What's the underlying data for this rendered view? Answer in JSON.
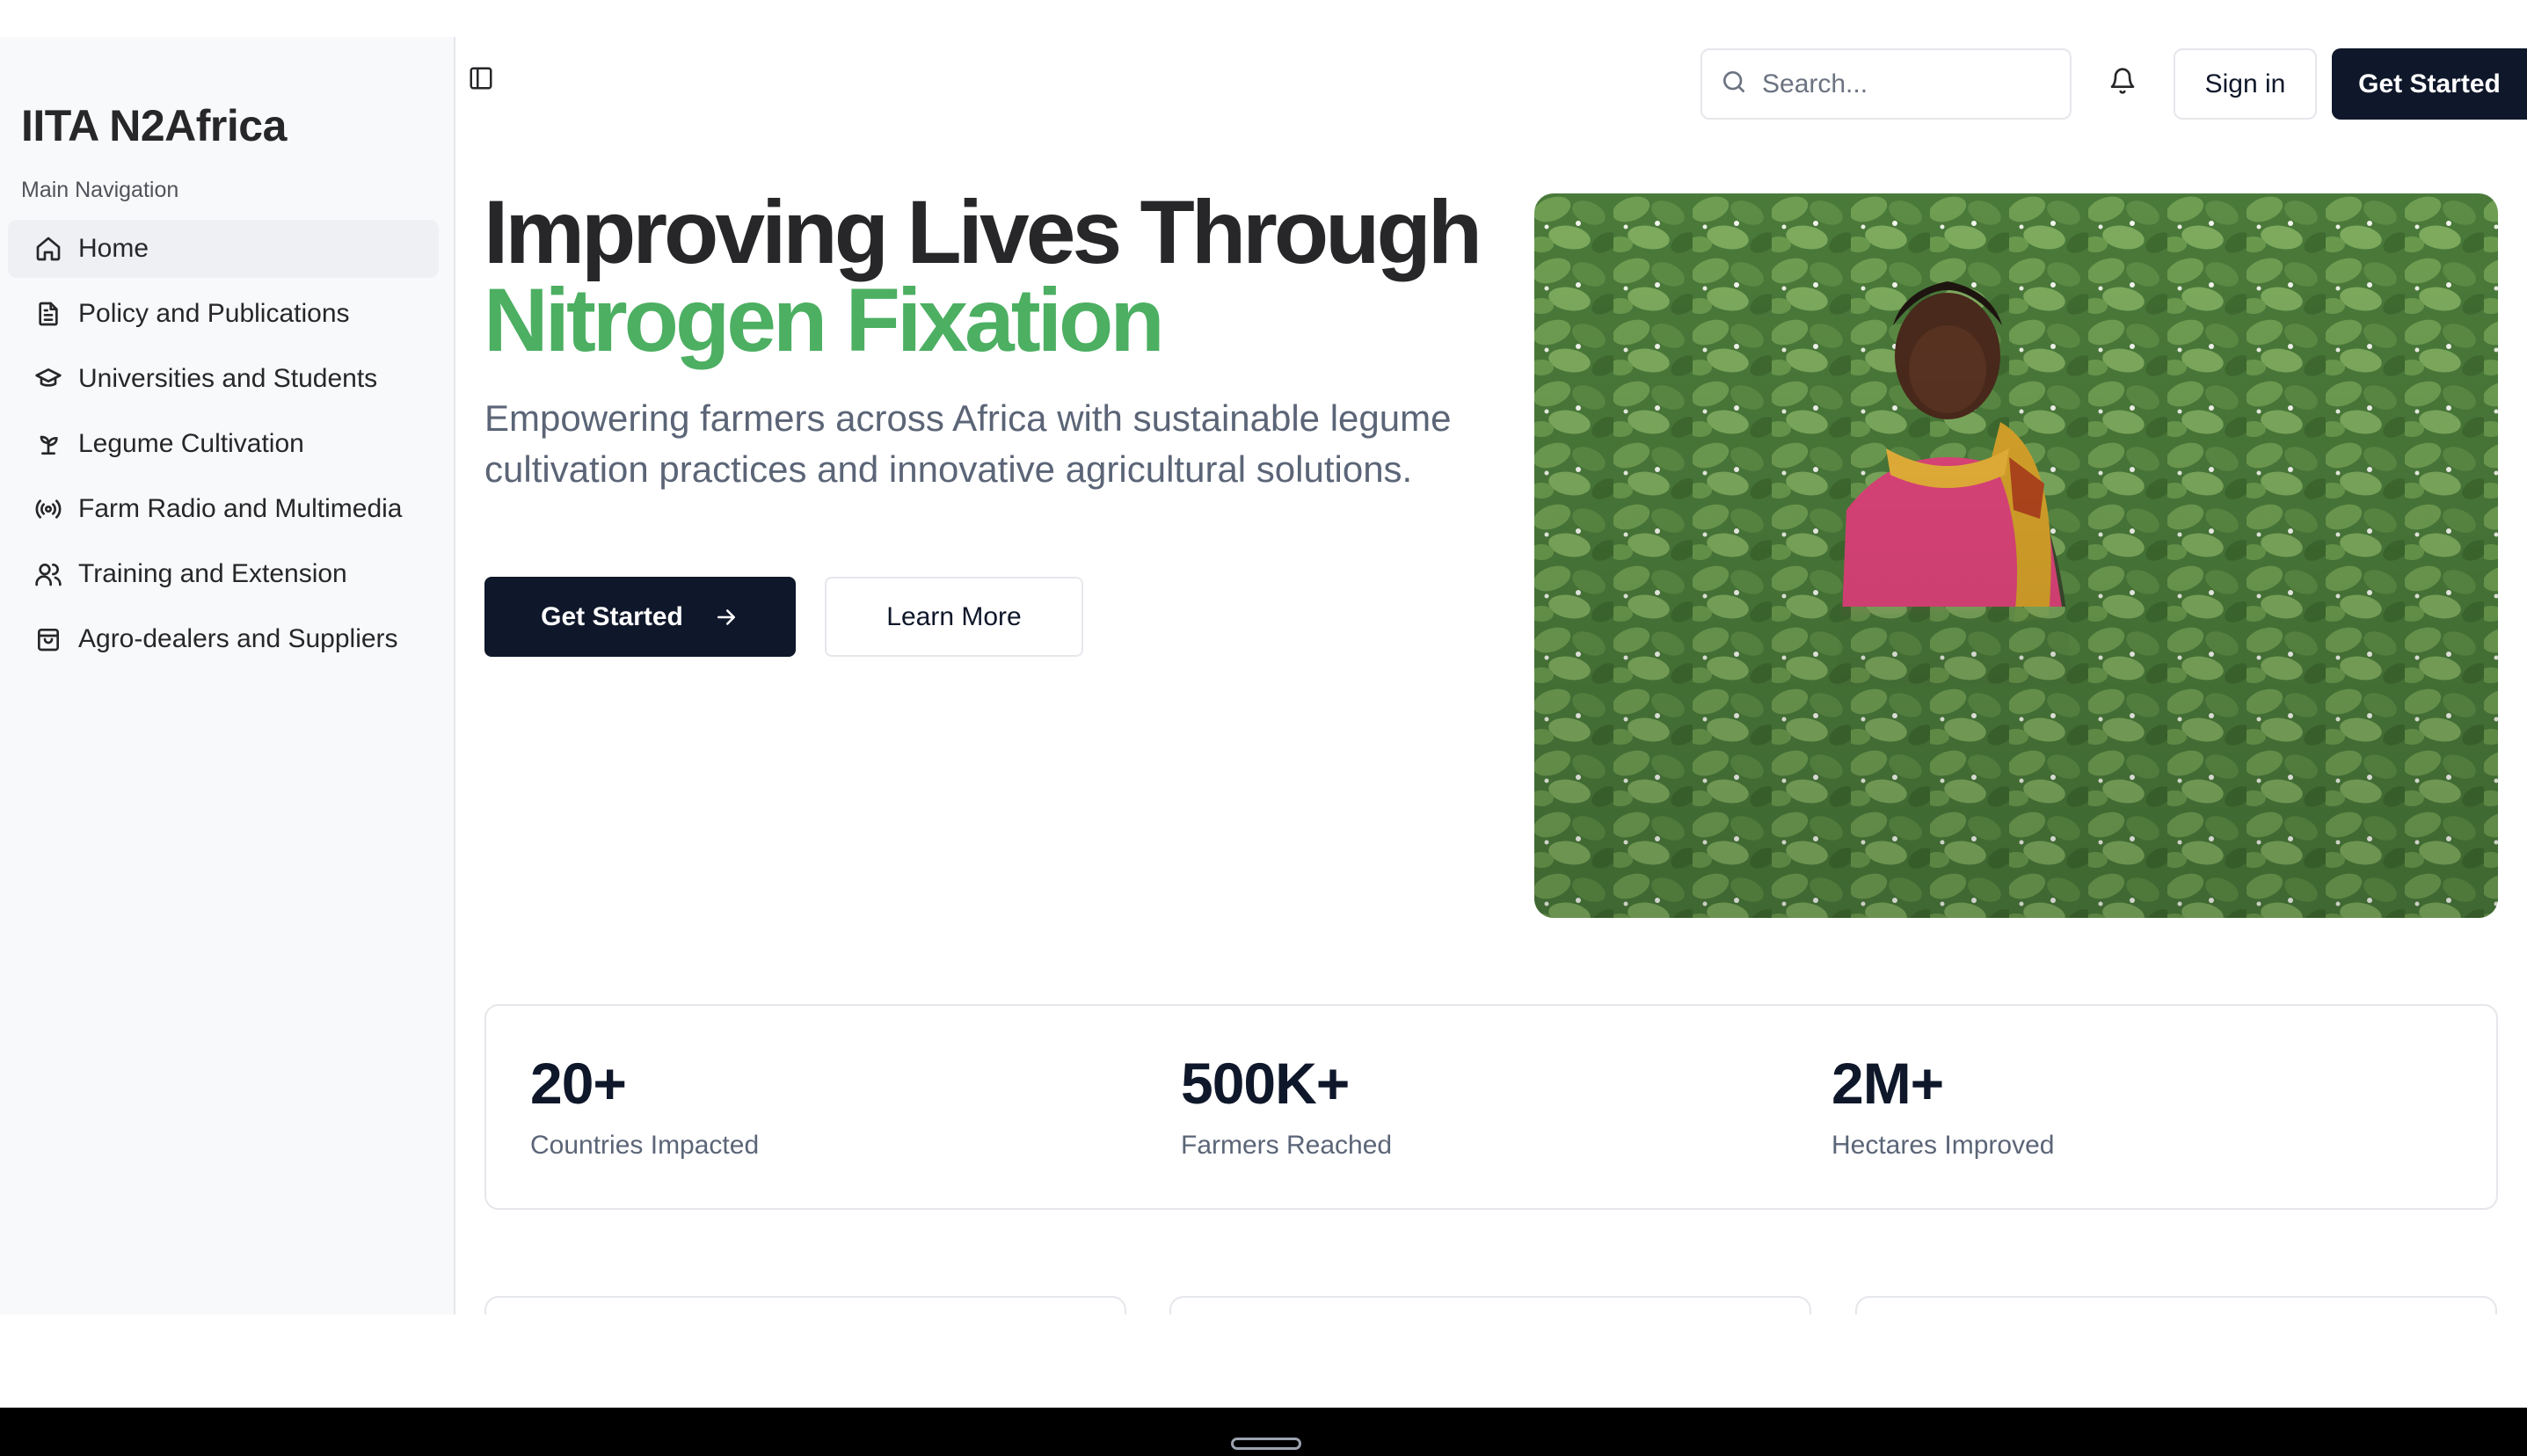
{
  "app": {
    "brand": "IITA N2Africa"
  },
  "sidebar": {
    "section_title": "Main Navigation",
    "items": [
      {
        "label": "Home",
        "icon": "home-icon",
        "active": true
      },
      {
        "label": "Policy and Publications",
        "icon": "document-icon",
        "active": false
      },
      {
        "label": "Universities and Students",
        "icon": "graduation-cap-icon",
        "active": false
      },
      {
        "label": "Legume Cultivation",
        "icon": "sprout-icon",
        "active": false
      },
      {
        "label": "Farm Radio and Multimedia",
        "icon": "radio-icon",
        "active": false
      },
      {
        "label": "Training and Extension",
        "icon": "users-icon",
        "active": false
      },
      {
        "label": "Agro-dealers and Suppliers",
        "icon": "shopping-bag-icon",
        "active": false
      }
    ]
  },
  "header": {
    "search_placeholder": "Search...",
    "sign_in_label": "Sign in",
    "get_started_label": "Get Started"
  },
  "hero": {
    "title_line1": "Improving Lives Through",
    "title_line2": "Nitrogen Fixation",
    "subtitle": "Empowering farmers across Africa with sustainable legume cultivation practices and innovative agricultural solutions.",
    "primary_cta": "Get Started",
    "secondary_cta": "Learn More"
  },
  "stats": [
    {
      "value": "20+",
      "label": "Countries Impacted"
    },
    {
      "value": "500K+",
      "label": "Farmers Reached"
    },
    {
      "value": "2M+",
      "label": "Hectares Improved"
    }
  ],
  "colors": {
    "primary": "#0f172a",
    "accent_green": "#4caf62",
    "sidebar_bg": "#f8f9fa",
    "muted_text": "#5b6577"
  }
}
